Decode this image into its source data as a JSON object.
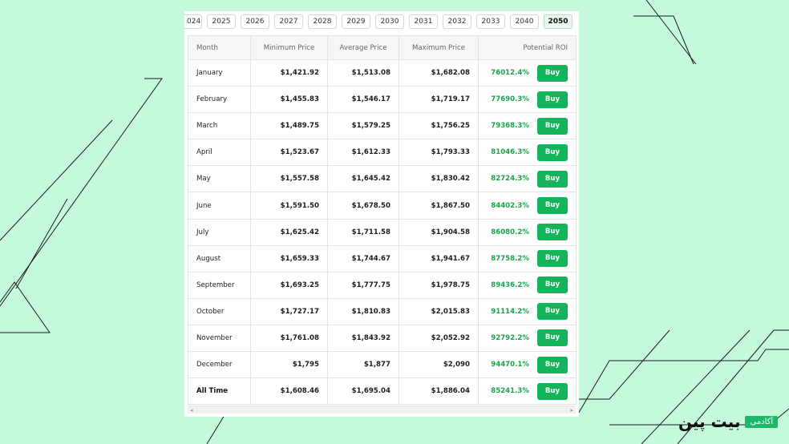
{
  "years": {
    "tabs": [
      "024",
      "2025",
      "2026",
      "2027",
      "2028",
      "2029",
      "2030",
      "2031",
      "2032",
      "2033",
      "2040",
      "2050"
    ],
    "active": "2050"
  },
  "table": {
    "headers": {
      "month": "Month",
      "min": "Minimum Price",
      "avg": "Average Price",
      "max": "Maximum Price",
      "roi": "Potential ROI"
    },
    "buy_label": "Buy",
    "rows": [
      {
        "month": "January",
        "min": "$1,421.92",
        "avg": "$1,513.08",
        "max": "$1,682.08",
        "roi": "76012.4%"
      },
      {
        "month": "February",
        "min": "$1,455.83",
        "avg": "$1,546.17",
        "max": "$1,719.17",
        "roi": "77690.3%"
      },
      {
        "month": "March",
        "min": "$1,489.75",
        "avg": "$1,579.25",
        "max": "$1,756.25",
        "roi": "79368.3%"
      },
      {
        "month": "April",
        "min": "$1,523.67",
        "avg": "$1,612.33",
        "max": "$1,793.33",
        "roi": "81046.3%"
      },
      {
        "month": "May",
        "min": "$1,557.58",
        "avg": "$1,645.42",
        "max": "$1,830.42",
        "roi": "82724.3%"
      },
      {
        "month": "June",
        "min": "$1,591.50",
        "avg": "$1,678.50",
        "max": "$1,867.50",
        "roi": "84402.3%"
      },
      {
        "month": "July",
        "min": "$1,625.42",
        "avg": "$1,711.58",
        "max": "$1,904.58",
        "roi": "86080.2%"
      },
      {
        "month": "August",
        "min": "$1,659.33",
        "avg": "$1,744.67",
        "max": "$1,941.67",
        "roi": "87758.2%"
      },
      {
        "month": "September",
        "min": "$1,693.25",
        "avg": "$1,777.75",
        "max": "$1,978.75",
        "roi": "89436.2%"
      },
      {
        "month": "October",
        "min": "$1,727.17",
        "avg": "$1,810.83",
        "max": "$2,015.83",
        "roi": "91114.2%"
      },
      {
        "month": "November",
        "min": "$1,761.08",
        "avg": "$1,843.92",
        "max": "$2,052.92",
        "roi": "92792.2%"
      },
      {
        "month": "December",
        "min": "$1,795",
        "avg": "$1,877",
        "max": "$2,090",
        "roi": "94470.1%"
      },
      {
        "month": "All Time",
        "min": "$1,608.46",
        "avg": "$1,695.04",
        "max": "$1,886.04",
        "roi": "85241.3%"
      }
    ]
  },
  "logo": {
    "name": "بیت پین",
    "badge": "آکادمی"
  },
  "colors": {
    "background": "#c5f9dc",
    "buy_button": "#14b45b",
    "roi_text": "#1aa34a"
  }
}
